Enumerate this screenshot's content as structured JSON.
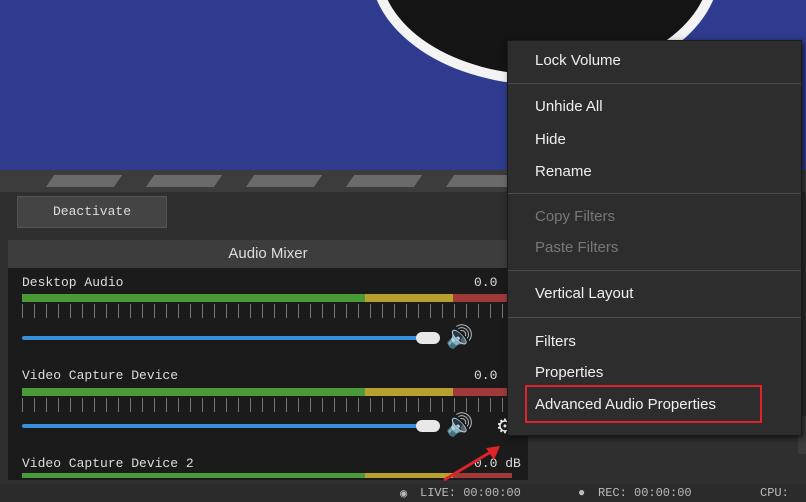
{
  "toolbar": {
    "deactivate_label": "Deactivate"
  },
  "mixer": {
    "title": "Audio Mixer",
    "devices": [
      {
        "name": "Desktop Audio",
        "value": "0.0"
      },
      {
        "name": "Video Capture Device",
        "value": "0.0"
      },
      {
        "name": "Video Capture Device 2",
        "value": "0.0 dB"
      }
    ]
  },
  "context_menu": {
    "items": [
      {
        "label": "Lock Volume",
        "enabled": true
      },
      {
        "label": "Unhide All",
        "enabled": true
      },
      {
        "label": "Hide",
        "enabled": true
      },
      {
        "label": "Rename",
        "enabled": true
      },
      {
        "label": "Copy Filters",
        "enabled": false
      },
      {
        "label": "Paste Filters",
        "enabled": false
      },
      {
        "label": "Vertical Layout",
        "enabled": true
      },
      {
        "label": "Filters",
        "enabled": true
      },
      {
        "label": "Properties",
        "enabled": true
      },
      {
        "label": "Advanced Audio Properties",
        "enabled": true,
        "highlighted": true
      }
    ]
  },
  "status": {
    "live": "LIVE: 00:00:00",
    "rec": "REC: 00:00:00",
    "cpu": "CPU:"
  },
  "colors": {
    "preview_bg": "#2e3b8f",
    "highlight_border": "#e0222a",
    "slider": "#3a8fdc",
    "arrow": "#e0222a"
  },
  "icons": {
    "volume": "speaker-icon",
    "gear": "gear-icon",
    "arrow": "red-arrow-annotation"
  }
}
